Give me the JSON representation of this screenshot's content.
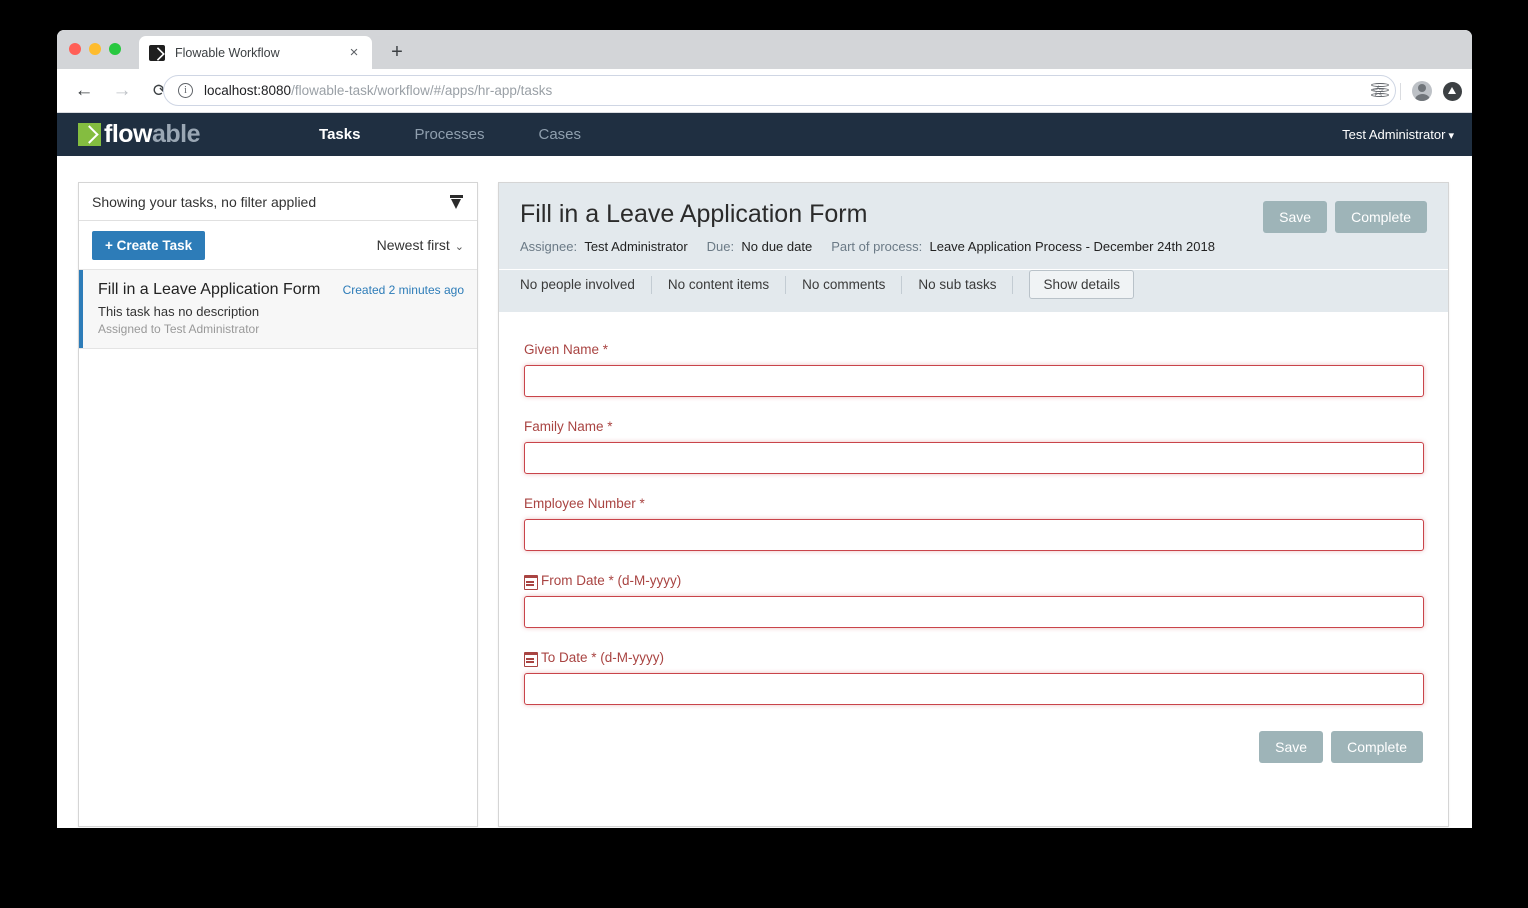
{
  "browser": {
    "tab_title": "Flowable Workflow",
    "favicon_name": "flowable-favicon",
    "close_label": "×",
    "new_tab_label": "+",
    "back_label": "←",
    "forward_label": "→",
    "reload_label": "⟳",
    "url_host": "localhost:8080",
    "url_path": "/flowable-task/workflow/#/apps/hr-app/tasks",
    "info_label": "i",
    "star_label": "☆"
  },
  "navbar": {
    "brand_first": "flow",
    "brand_second": "able",
    "links": [
      {
        "label": "Tasks",
        "active": true
      },
      {
        "label": "Processes",
        "active": false
      },
      {
        "label": "Cases",
        "active": false
      }
    ],
    "user": "Test Administrator",
    "user_caret": "▾"
  },
  "task_panel": {
    "filter_text": "Showing your tasks, no filter applied",
    "create_button": "+ Create Task",
    "sort_label": "Newest first",
    "sort_caret": "⌄",
    "tasks": [
      {
        "title": "Fill in a Leave Application Form",
        "time": "Created 2 minutes ago",
        "description": "This task has no description",
        "assignee": "Assigned to Test Administrator"
      }
    ]
  },
  "detail": {
    "title": "Fill in a Leave Application Form",
    "assignee_label": "Assignee:",
    "assignee_value": "Test Administrator",
    "due_label": "Due:",
    "due_value": "No due date",
    "process_label": "Part of process:",
    "process_value": "Leave Application Process - December 24th 2018",
    "save_label": "Save",
    "complete_label": "Complete",
    "tabs": [
      "No people involved",
      "No content items",
      "No comments",
      "No sub tasks"
    ],
    "show_details_label": "Show details"
  },
  "form": {
    "fields": [
      {
        "label": "Given Name *",
        "value": "",
        "icon": "",
        "type": "text"
      },
      {
        "label": "Family Name *",
        "value": "",
        "icon": "",
        "type": "text"
      },
      {
        "label": "Employee Number *",
        "value": "",
        "icon": "",
        "type": "text"
      },
      {
        "label": "From Date * (d-M-yyyy)",
        "value": "",
        "icon": "calendar-icon",
        "type": "date"
      },
      {
        "label": "To Date * (d-M-yyyy)",
        "value": "",
        "icon": "calendar-icon",
        "type": "date"
      }
    ],
    "save_label": "Save",
    "complete_label": "Complete"
  },
  "colors": {
    "navbar_bg": "#1f2f41",
    "brand_green": "#84bd40",
    "accent_blue": "#2d7cb8",
    "muted_button": "#9eb4b8",
    "validation_red": "#a94442",
    "header_bg": "#e3e9ed"
  }
}
